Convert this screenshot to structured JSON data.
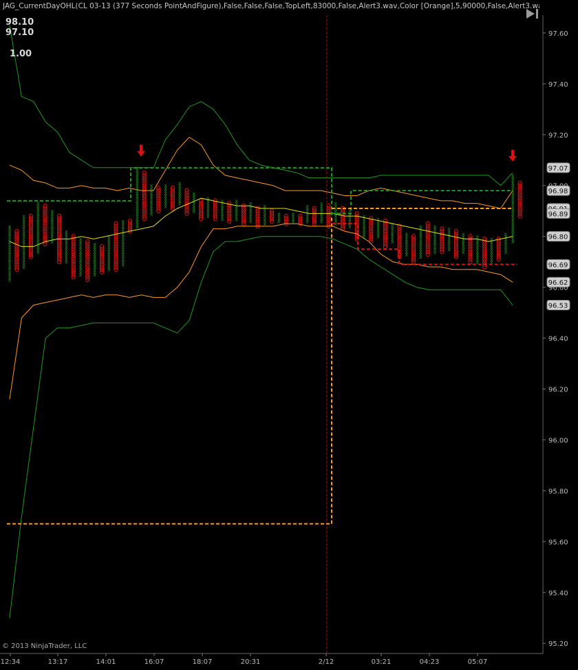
{
  "header": {
    "title": "JAG_CurrentDayOHL(CL 03-13 (377 Seconds PointAndFigure),False,False,False,TopLeft,83000,False,Alert3.wav,Color [Orange],5,90000,False,Alert3.wav,C",
    "value_top": "98.10",
    "value_mid": "97.10",
    "value_low": "1.00"
  },
  "footer": {
    "copyright": "© 2013 NinjaTrader, LLC"
  },
  "colors": {
    "background": "#000000",
    "x_color": "#1e8c1e",
    "o_color": "#e01010",
    "green_band": "#1f9a1f",
    "orange_band": "#ff9a1a",
    "yellow_line": "#e8e000",
    "divider": "#b01010"
  },
  "chart_data": {
    "type": "line",
    "title": "JAG_CurrentDayOHL(CL 03-13 (377 Seconds PointAndFigure)",
    "xlabel": "",
    "ylabel": "",
    "ylim": [
      95.16,
      97.67
    ],
    "y_ticks": [
      "97.60",
      "97.40",
      "97.20",
      "97.00",
      "96.80",
      "96.60",
      "96.40",
      "96.20",
      "96.00",
      "95.80",
      "95.60",
      "95.40",
      "95.20"
    ],
    "x_ticks": [
      "12:34",
      "13:17",
      "14:01",
      "16:07",
      "18:07",
      "20:31",
      "2/12",
      "03:21",
      "04:23",
      "05:07"
    ],
    "box_size": 0.01,
    "pnf_columns": [
      {
        "type": "X",
        "low": 96.63,
        "high": 96.84
      },
      {
        "type": "O",
        "low": 96.67,
        "high": 96.82
      },
      {
        "type": "X",
        "low": 96.68,
        "high": 96.88
      },
      {
        "type": "O",
        "low": 96.72,
        "high": 96.88
      },
      {
        "type": "X",
        "low": 96.74,
        "high": 96.93
      },
      {
        "type": "O",
        "low": 96.77,
        "high": 96.92
      },
      {
        "type": "X",
        "low": 96.78,
        "high": 96.9
      },
      {
        "type": "O",
        "low": 96.7,
        "high": 96.88
      },
      {
        "type": "X",
        "low": 96.7,
        "high": 96.82
      },
      {
        "type": "O",
        "low": 96.64,
        "high": 96.8
      },
      {
        "type": "X",
        "low": 96.65,
        "high": 96.79
      },
      {
        "type": "O",
        "low": 96.63,
        "high": 96.78
      },
      {
        "type": "X",
        "low": 96.65,
        "high": 96.77
      },
      {
        "type": "O",
        "low": 96.66,
        "high": 96.76
      },
      {
        "type": "X",
        "low": 96.67,
        "high": 96.8
      },
      {
        "type": "O",
        "low": 96.67,
        "high": 96.85
      },
      {
        "type": "X",
        "low": 96.69,
        "high": 96.86
      },
      {
        "type": "O",
        "low": 96.82,
        "high": 96.86
      },
      {
        "type": "X",
        "low": 96.84,
        "high": 97.07
      },
      {
        "type": "O",
        "low": 96.87,
        "high": 97.05
      },
      {
        "type": "X",
        "low": 96.89,
        "high": 97.0
      },
      {
        "type": "O",
        "low": 96.9,
        "high": 96.99
      },
      {
        "type": "X",
        "low": 96.92,
        "high": 97.0
      },
      {
        "type": "O",
        "low": 96.91,
        "high": 96.99
      },
      {
        "type": "X",
        "low": 96.93,
        "high": 97.01
      },
      {
        "type": "O",
        "low": 96.89,
        "high": 96.98
      },
      {
        "type": "X",
        "low": 96.9,
        "high": 96.97
      },
      {
        "type": "O",
        "low": 96.87,
        "high": 96.94
      },
      {
        "type": "X",
        "low": 96.88,
        "high": 96.95
      },
      {
        "type": "O",
        "low": 96.87,
        "high": 96.94
      },
      {
        "type": "X",
        "low": 96.87,
        "high": 96.94
      },
      {
        "type": "O",
        "low": 96.86,
        "high": 96.93
      },
      {
        "type": "X",
        "low": 96.87,
        "high": 96.94
      },
      {
        "type": "O",
        "low": 96.85,
        "high": 96.92
      },
      {
        "type": "X",
        "low": 96.86,
        "high": 96.93
      },
      {
        "type": "O",
        "low": 96.84,
        "high": 96.91
      },
      {
        "type": "X",
        "low": 96.85,
        "high": 96.92
      },
      {
        "type": "O",
        "low": 96.86,
        "high": 96.9
      },
      {
        "type": "X",
        "low": 96.86,
        "high": 96.89
      },
      {
        "type": "O",
        "low": 96.85,
        "high": 96.88
      },
      {
        "type": "X",
        "low": 96.86,
        "high": 96.89
      },
      {
        "type": "O",
        "low": 96.85,
        "high": 96.88
      },
      {
        "type": "X",
        "low": 96.86,
        "high": 96.92
      },
      {
        "type": "O",
        "low": 96.85,
        "high": 96.91
      },
      {
        "type": "X",
        "low": 96.86,
        "high": 96.93
      },
      {
        "type": "O",
        "low": 96.84,
        "high": 96.92
      },
      {
        "type": "X",
        "low": 96.85,
        "high": 96.93
      },
      {
        "type": "O",
        "low": 96.83,
        "high": 96.91
      },
      {
        "type": "X",
        "low": 96.84,
        "high": 96.9
      },
      {
        "type": "O",
        "low": 96.79,
        "high": 96.89
      },
      {
        "type": "X",
        "low": 96.8,
        "high": 96.88
      },
      {
        "type": "O",
        "low": 96.78,
        "high": 96.87
      },
      {
        "type": "X",
        "low": 96.8,
        "high": 96.87
      },
      {
        "type": "O",
        "low": 96.76,
        "high": 96.86
      },
      {
        "type": "X",
        "low": 96.78,
        "high": 96.85
      },
      {
        "type": "O",
        "low": 96.72,
        "high": 96.84
      },
      {
        "type": "X",
        "low": 96.73,
        "high": 96.81
      },
      {
        "type": "O",
        "low": 96.7,
        "high": 96.8
      },
      {
        "type": "X",
        "low": 96.72,
        "high": 96.84
      },
      {
        "type": "O",
        "low": 96.73,
        "high": 96.85
      },
      {
        "type": "X",
        "low": 96.74,
        "high": 96.84
      },
      {
        "type": "O",
        "low": 96.74,
        "high": 96.83
      },
      {
        "type": "X",
        "low": 96.75,
        "high": 96.83
      },
      {
        "type": "O",
        "low": 96.72,
        "high": 96.82
      },
      {
        "type": "X",
        "low": 96.74,
        "high": 96.81
      },
      {
        "type": "O",
        "low": 96.7,
        "high": 96.8
      },
      {
        "type": "X",
        "low": 96.7,
        "high": 96.8
      },
      {
        "type": "O",
        "low": 96.68,
        "high": 96.79
      },
      {
        "type": "X",
        "low": 96.7,
        "high": 96.79
      },
      {
        "type": "O",
        "low": 96.71,
        "high": 96.79
      },
      {
        "type": "X",
        "low": 96.74,
        "high": 96.81
      },
      {
        "type": "X",
        "low": 96.78,
        "high": 97.04
      },
      {
        "type": "O",
        "low": 96.88,
        "high": 97.01
      }
    ],
    "series": [
      {
        "name": "upper band",
        "color": "#1f9a1f",
        "values": [
          97.63,
          97.35,
          97.33,
          97.25,
          97.21,
          97.13,
          97.1,
          97.07,
          97.07,
          97.07,
          97.07,
          97.07,
          97.07,
          97.18,
          97.24,
          97.31,
          97.33,
          97.3,
          97.24,
          97.16,
          97.1,
          97.08,
          97.07,
          97.06,
          97.05,
          97.03,
          97.03,
          97.03,
          97.03,
          97.03,
          97.03,
          97.04,
          97.04,
          97.04,
          97.04,
          97.04,
          97.04,
          97.04,
          97.04,
          97.04,
          97.04,
          97.0,
          97.05
        ]
      },
      {
        "name": "upper inner",
        "color": "#ff9a1a",
        "values": [
          97.08,
          97.06,
          97.02,
          97.01,
          96.99,
          96.99,
          97.0,
          96.99,
          96.99,
          96.98,
          96.99,
          96.98,
          96.98,
          97.06,
          97.14,
          97.19,
          97.16,
          97.08,
          97.04,
          97.03,
          97.02,
          97.01,
          97.0,
          96.98,
          96.98,
          96.98,
          96.98,
          96.97,
          96.96,
          96.96,
          96.98,
          96.99,
          96.98,
          96.97,
          96.96,
          96.95,
          96.94,
          96.94,
          96.93,
          96.93,
          96.92,
          96.91,
          96.98
        ]
      },
      {
        "name": "mid",
        "color": "#e8e000",
        "values": [
          96.78,
          96.76,
          96.76,
          96.78,
          96.79,
          96.79,
          96.8,
          96.79,
          96.8,
          96.81,
          96.82,
          96.83,
          96.84,
          96.88,
          96.91,
          96.93,
          96.95,
          96.94,
          96.93,
          96.92,
          96.92,
          96.91,
          96.91,
          96.91,
          96.9,
          96.89,
          96.89,
          96.89,
          96.88,
          96.88,
          96.87,
          96.86,
          96.85,
          96.84,
          96.83,
          96.82,
          96.81,
          96.8,
          96.79,
          96.79,
          96.78,
          96.79,
          96.8
        ]
      },
      {
        "name": "lower inner",
        "color": "#ff9a1a",
        "values": [
          96.16,
          96.48,
          96.53,
          96.54,
          96.55,
          96.56,
          96.57,
          96.56,
          96.57,
          96.57,
          96.56,
          96.57,
          96.56,
          96.56,
          96.6,
          96.66,
          96.76,
          96.83,
          96.83,
          96.84,
          96.84,
          96.84,
          96.84,
          96.85,
          96.85,
          96.84,
          96.84,
          96.84,
          96.82,
          96.81,
          96.78,
          96.73,
          96.7,
          96.69,
          96.69,
          96.68,
          96.68,
          96.67,
          96.67,
          96.67,
          96.66,
          96.65,
          96.62
        ]
      },
      {
        "name": "lower band",
        "color": "#1f9a1f",
        "values": [
          95.3,
          95.7,
          96.05,
          96.4,
          96.44,
          96.44,
          96.45,
          96.46,
          96.46,
          96.46,
          96.46,
          96.46,
          96.46,
          96.44,
          96.42,
          96.47,
          96.62,
          96.74,
          96.78,
          96.78,
          96.79,
          96.8,
          96.8,
          96.8,
          96.8,
          96.8,
          96.8,
          96.79,
          96.77,
          96.75,
          96.71,
          96.68,
          96.65,
          96.62,
          96.6,
          96.59,
          96.59,
          96.59,
          96.59,
          96.59,
          96.59,
          96.59,
          96.53
        ]
      }
    ],
    "levels": [
      {
        "label": "97.07",
        "value": 97.07,
        "color": "#1f9a1f",
        "style": "dashed"
      },
      {
        "label": "96.98",
        "value": 96.98,
        "color": "#1f9a1f",
        "style": "dashed"
      },
      {
        "label": "96.91",
        "value": 96.91,
        "color": "#ff9a1a",
        "style": "dashed"
      },
      {
        "label": "96.89",
        "value": 96.89,
        "color": "#e8e000",
        "style": "dashed"
      },
      {
        "label": "96.80",
        "value": 96.8,
        "color": "#1f9a1f",
        "style": "solid"
      },
      {
        "label": "96.69",
        "value": 96.69,
        "color": "#e01010",
        "style": "dashed"
      },
      {
        "label": "96.62",
        "value": 96.62,
        "color": "#ff9a1a",
        "style": "solid"
      },
      {
        "label": "96.53",
        "value": 96.53,
        "color": "#1f9a1f",
        "style": "solid"
      }
    ],
    "prior_day": {
      "high": 97.07,
      "open": 96.94,
      "low": 95.67,
      "close": 96.88
    },
    "alerts": [
      {
        "type": "down-arrow",
        "value": 97.09
      },
      {
        "type": "down-arrow",
        "value": 97.07
      }
    ],
    "grid": false,
    "legend": "none"
  }
}
